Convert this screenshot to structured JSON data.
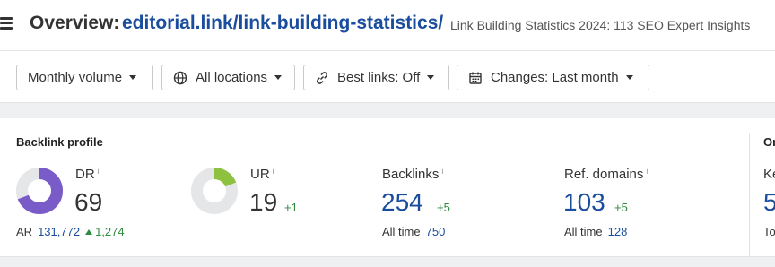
{
  "header": {
    "title_prefix": "Overview:",
    "title_url": "editorial.link/link-building-statistics/",
    "subtitle": "Link Building Statistics 2024: 113 SEO Expert Insights"
  },
  "filters": [
    {
      "label": "Monthly volume",
      "icon": "none"
    },
    {
      "label": "All locations",
      "icon": "globe-icon"
    },
    {
      "label": "Best links: Off",
      "icon": "link-icon"
    },
    {
      "label": "Changes: Last month",
      "icon": "calendar-icon"
    }
  ],
  "panel": {
    "title": "Backlink profile",
    "next_title_partial": "Or",
    "dr": {
      "label": "DR",
      "info": "i",
      "value": "69",
      "fill_fraction": 0.69,
      "color": "#7a5cc8"
    },
    "ar": {
      "label": "AR",
      "value": "131,772",
      "change": "1,274"
    },
    "ur": {
      "label": "UR",
      "info": "i",
      "value": "19",
      "delta": "+1",
      "fill_fraction": 0.19,
      "color": "#8fc140"
    },
    "backlinks": {
      "label": "Backlinks",
      "info": "i",
      "value": "254",
      "delta": "+5",
      "all_time_label": "All time",
      "all_time_value": "750"
    },
    "ref_domains": {
      "label": "Ref. domains",
      "info": "i",
      "value": "103",
      "delta": "+5",
      "all_time_label": "All time",
      "all_time_value": "128"
    },
    "cut_off_label": "Ke",
    "cut_off_value": "5",
    "cut_off_foot": "To"
  },
  "colors": {
    "link_blue": "#1a4d9e",
    "positive_green": "#2e8b3d",
    "donut_track": "#e5e6e8"
  }
}
